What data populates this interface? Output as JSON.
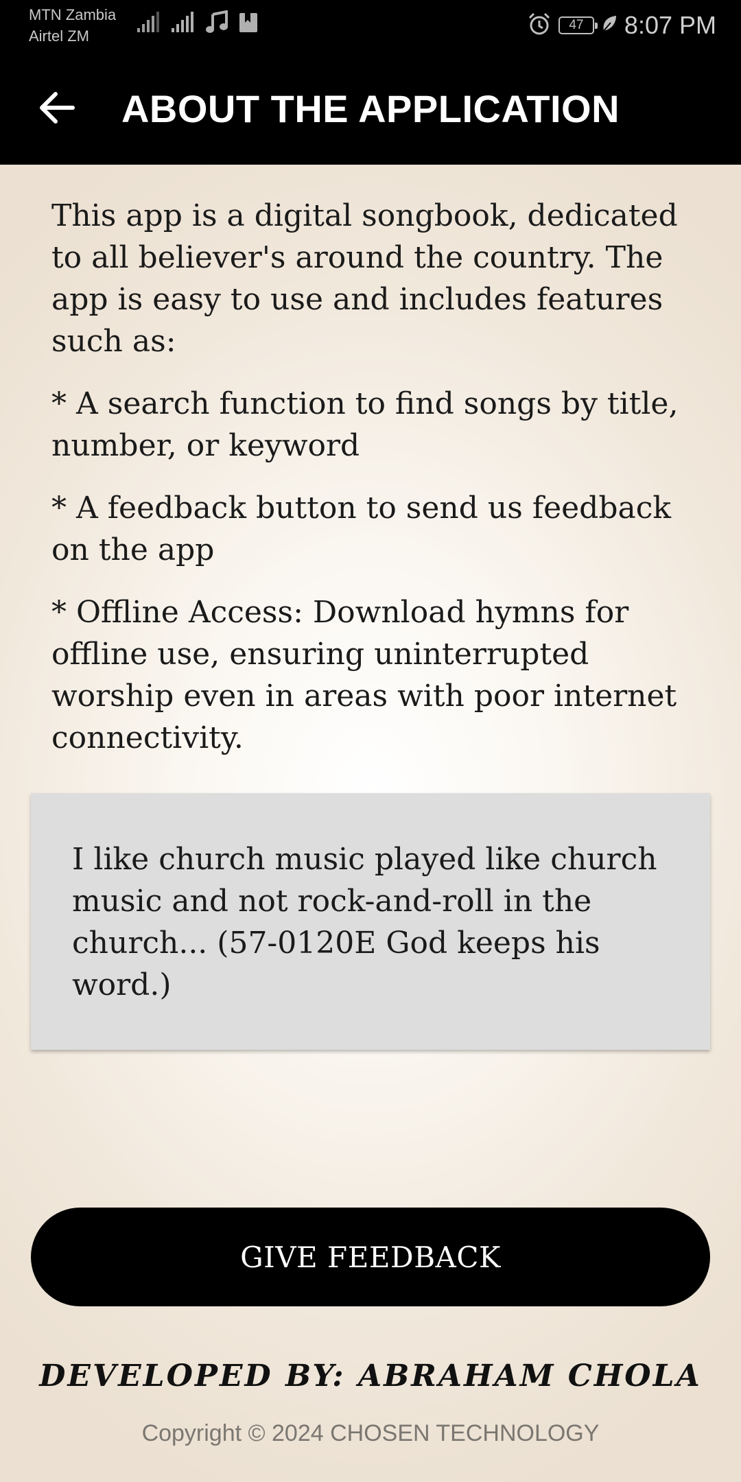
{
  "status_bar": {
    "carrier_1": "MTN Zambia",
    "carrier_2": "Airtel ZM",
    "battery": "47",
    "time": "8:07 PM",
    "icons": [
      "signal-icon",
      "signal-icon",
      "music-note-icon",
      "notification-icon",
      "alarm-icon",
      "battery-icon",
      "leaf-icon"
    ]
  },
  "app_bar": {
    "back_icon": "arrow-back-icon",
    "title": "ABOUT THE APPLICATION"
  },
  "about": {
    "intro": "This app is a digital songbook, dedicated to all believer's around the country. The app is easy to use and includes features such as:",
    "features": [
      "* A search function to find songs by title, number, or keyword",
      "* A feedback button to send us feedback on the app",
      "* Offline Access: Download hymns for offline use, ensuring uninterrupted worship even in areas with poor internet connectivity."
    ]
  },
  "quote": {
    "text": "I like church music played like church music and not rock-and-roll in the church... (57-0120E God keeps his word.)"
  },
  "feedback_button": {
    "label": "GIVE FEEDBACK"
  },
  "footer": {
    "developer": "DEVELOPED BY: ABRAHAM CHOLA",
    "copyright": "Copyright © 2024 CHOSEN TECHNOLOGY"
  },
  "colors": {
    "bar_background": "#000000",
    "content_background": "#f1e8dc",
    "quote_background": "#dddddd",
    "button_background": "#000000"
  }
}
